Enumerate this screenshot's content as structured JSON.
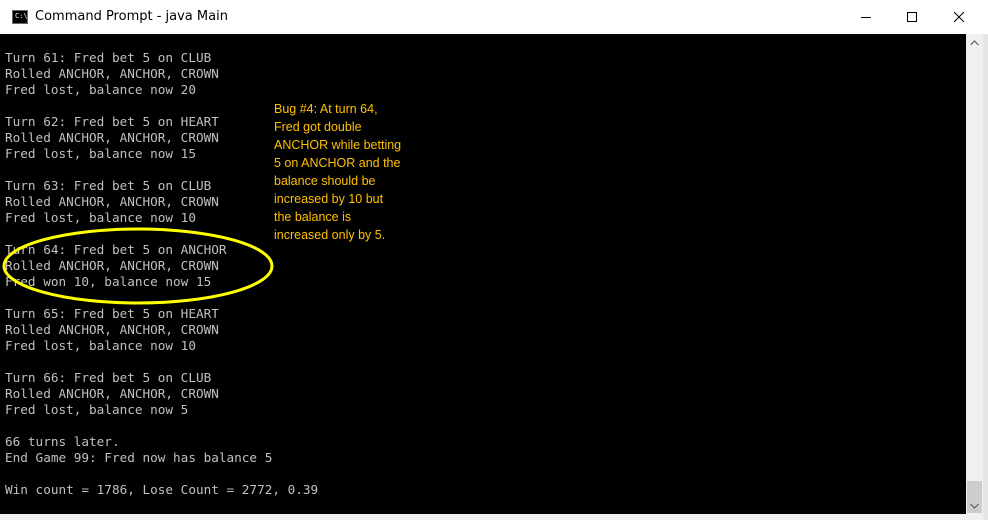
{
  "window": {
    "title": "Command Prompt - java  Main",
    "icon": "cmd-icon",
    "icon_glyph": "C:\\"
  },
  "console": {
    "lines": [
      "Turn 61: Fred bet 5 on CLUB",
      "Rolled ANCHOR, ANCHOR, CROWN",
      "Fred lost, balance now 20",
      "",
      "Turn 62: Fred bet 5 on HEART",
      "Rolled ANCHOR, ANCHOR, CROWN",
      "Fred lost, balance now 15",
      "",
      "Turn 63: Fred bet 5 on CLUB",
      "Rolled ANCHOR, ANCHOR, CROWN",
      "Fred lost, balance now 10",
      "",
      "Turn 64: Fred bet 5 on ANCHOR",
      "Rolled ANCHOR, ANCHOR, CROWN",
      "Fred won 10, balance now 15",
      "",
      "Turn 65: Fred bet 5 on HEART",
      "Rolled ANCHOR, ANCHOR, CROWN",
      "Fred lost, balance now 10",
      "",
      "Turn 66: Fred bet 5 on CLUB",
      "Rolled ANCHOR, ANCHOR, CROWN",
      "Fred lost, balance now 5",
      "",
      "66 turns later.",
      "End Game 99: Fred now has balance 5",
      "",
      "Win count = 1786, Lose Count = 2772, 0.39"
    ]
  },
  "annotation": {
    "lines": [
      "Bug #4: At turn 64,",
      "Fred got double",
      "ANCHOR while betting",
      "5 on ANCHOR and the",
      "balance should be",
      "increased by 10 but",
      "the balance is",
      "increased only by 5."
    ],
    "color": "#ffc000",
    "highlight_color": "#ffff00"
  },
  "colors": {
    "console_bg": "#000000",
    "console_text": "#c0c0c0",
    "titlebar_bg": "#ffffff"
  }
}
